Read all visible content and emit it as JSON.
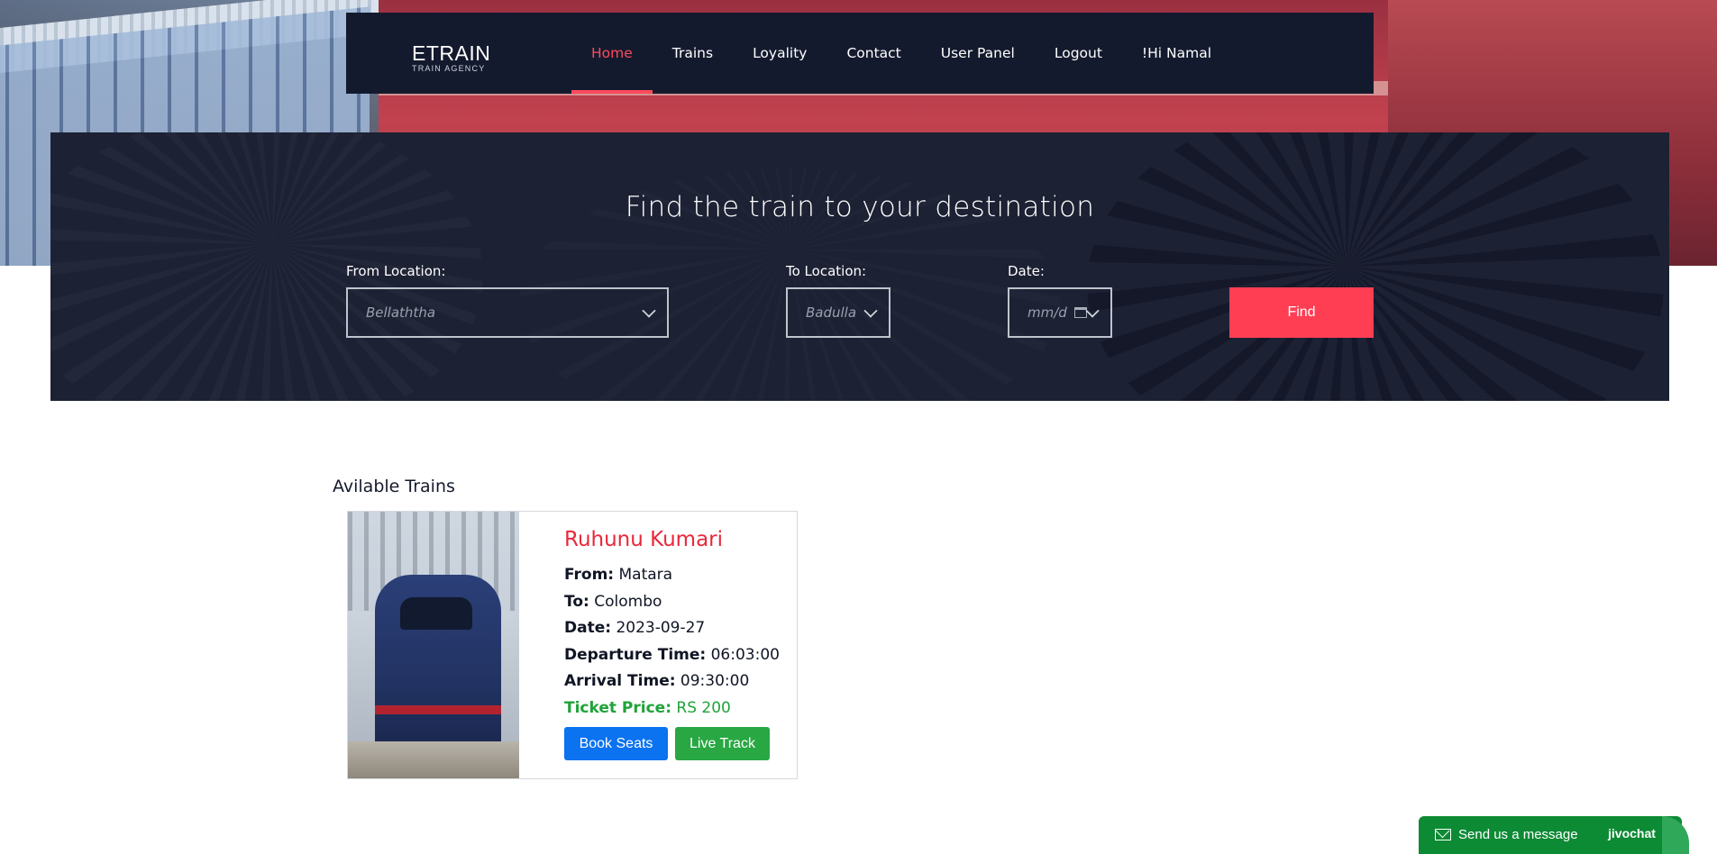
{
  "brand": {
    "title": "ETRAIN",
    "subtitle": "TRAIN AGENCY"
  },
  "nav": {
    "items": [
      {
        "label": "Home",
        "active": true
      },
      {
        "label": "Trains"
      },
      {
        "label": "Loyality"
      },
      {
        "label": "Contact"
      },
      {
        "label": "User Panel"
      },
      {
        "label": "Logout"
      },
      {
        "label": "!Hi Namal"
      }
    ]
  },
  "search": {
    "title": "Find the train to your destination",
    "from_label": "From Location:",
    "from_value": "Bellaththa",
    "to_label": "To Location:",
    "to_value": "Badulla",
    "date_label": "Date:",
    "date_placeholder": "mm/d",
    "find_label": "Find"
  },
  "results": {
    "title": "Avilable Trains",
    "trains": [
      {
        "name": "Ruhunu Kumari",
        "from_label": "From:",
        "from": "Matara",
        "to_label": "To:",
        "to": "Colombo",
        "date_label": "Date:",
        "date": "2023-09-27",
        "departure_label": "Departure Time:",
        "departure": "06:03:00",
        "arrival_label": "Arrival Time:",
        "arrival": "09:30:00",
        "price_label": "Ticket Price:",
        "price": "RS 200",
        "book_label": "Book Seats",
        "track_label": "Live Track"
      }
    ]
  },
  "chat": {
    "label": "Send us a message",
    "brand": "jivochat",
    "icon": "envelope-icon"
  },
  "colors": {
    "accent": "#ff3e54",
    "nav_bg": "#141a2e",
    "book": "#0b72f0",
    "track": "#28a743",
    "price": "#1fa33a"
  }
}
